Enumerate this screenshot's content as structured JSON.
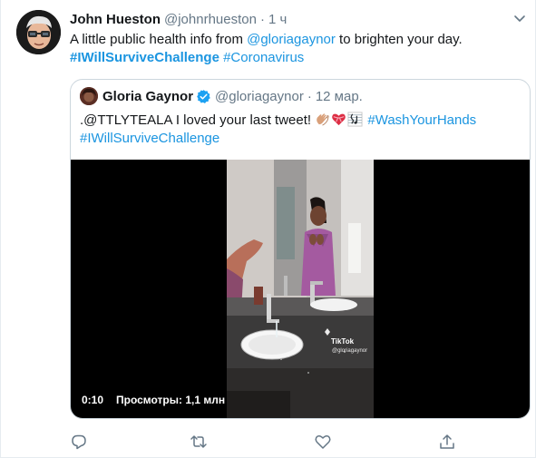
{
  "tweet": {
    "author_name": "John Hueston",
    "author_handle": "@johnrhueston",
    "separator": "·",
    "time": "1 ч",
    "text_before": "A little public health info from ",
    "mention": "@gloriagaynor",
    "text_after": " to brighten your day.",
    "hashtag_1": "#IWillSurviveChallenge",
    "hashtag_2": "#Coronavirus"
  },
  "quoted": {
    "author_name": "Gloria Gaynor",
    "author_handle": "@gloriagaynor",
    "separator": "·",
    "date": "12 мар.",
    "text": ".@TTLYTEALA I loved your last tweet! ",
    "hashtag_1": "#WashYourHands",
    "hashtag_2": "#IWillSurviveChallenge",
    "emojis": [
      "clapping-hands-icon",
      "heart-with-ribbon-icon",
      "musical-score-icon"
    ],
    "video": {
      "duration": "0:10",
      "views": "Просмотры: 1,1 млн",
      "watermark": "TikTok",
      "watermark_user": "@gloriagaynor"
    }
  },
  "actions": [
    "reply-icon",
    "retweet-icon",
    "like-icon",
    "share-icon"
  ],
  "colors": {
    "link": "#1b95e0",
    "muted": "#657786",
    "verified": "#1da1f2",
    "border": "#ccd6dd"
  }
}
